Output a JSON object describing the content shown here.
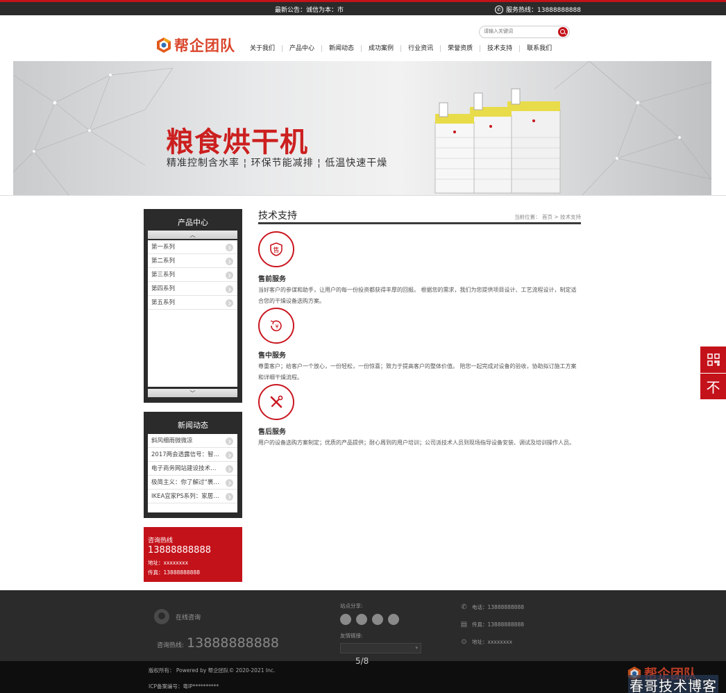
{
  "topbar": {
    "notice": "最新公告：诚信为本：市",
    "hotline": "服务热线：13888888888"
  },
  "header": {
    "logo_text": "帮企团队",
    "search_placeholder": "请输入关键词",
    "nav": [
      "关于我们",
      "产品中心",
      "新闻动态",
      "成功案例",
      "行业资讯",
      "荣誉资质",
      "技术支持",
      "联系我们"
    ]
  },
  "banner": {
    "title": "粮食烘干机",
    "subtitle": "精准控制含水率 ¦ 环保节能减排 ¦ 低温快速干燥"
  },
  "sidebar": {
    "products": {
      "title": "产品中心",
      "items": [
        "第一系列",
        "第二系列",
        "第三系列",
        "第四系列",
        "第五系列"
      ]
    },
    "news": {
      "title": "新闻动态",
      "items": [
        "斜风细雨微微凉",
        "2017两会透露信号：智能卫...",
        "电子商务网站建设技术：怎...",
        "极简主义：你了解过“裹脚...",
        "IKEA宜家PS系列：家居可以..."
      ]
    },
    "contact": {
      "label": "咨询热线",
      "phone": "13888888888",
      "address": "地址：xxxxxxxx",
      "fax": "传真：13888888888"
    }
  },
  "main": {
    "title": "技术支持",
    "breadcrumb": "当前位置： 首页 > 技术支持",
    "services": [
      {
        "icon": "售",
        "title": "售前服务",
        "desc": "当好客户的参谋和助手，让用户的每一份投资都获得丰厚的回报。 根据您的需求，我们为您提供项目设计、工艺流程设计，制定适合您的干燥设备选购方案。"
      },
      {
        "icon": "¥",
        "title": "售中服务",
        "desc": "尊重客户；给客户一个放心，一份轻松，一份惊喜；致力于提高客户的整体价值。 陪您一起完成对设备的验收，协助拟订施工方案和详细干燥流程。"
      },
      {
        "icon": "tools",
        "title": "售后服务",
        "desc": "用户的设备选购方案制定；优质的产品提供；耐心周到的用户培训；公司派技术人员到现场指导设备安装、调试及培训操作人员。"
      }
    ]
  },
  "float": {
    "top_label": "不"
  },
  "footer": {
    "online": "在线咨询",
    "hot_label": "咨询热线:",
    "hot_number": "13888888888",
    "share_label": "站点分享:",
    "links_label": "友情链接:",
    "phone": "电话：13888888888",
    "fax": "传真：13888888888",
    "address": "地址：xxxxxxxx"
  },
  "bottom": {
    "copyright": "版权所有： Powered by 帮企团队© 2020-2021 Inc.",
    "icp": "ICP备案编号：粤IP**********"
  },
  "page_indicator": "5/8",
  "watermark": "春哥技术博客",
  "colors": {
    "brand_red": "#c4121a",
    "dark": "#2b2b2b"
  }
}
